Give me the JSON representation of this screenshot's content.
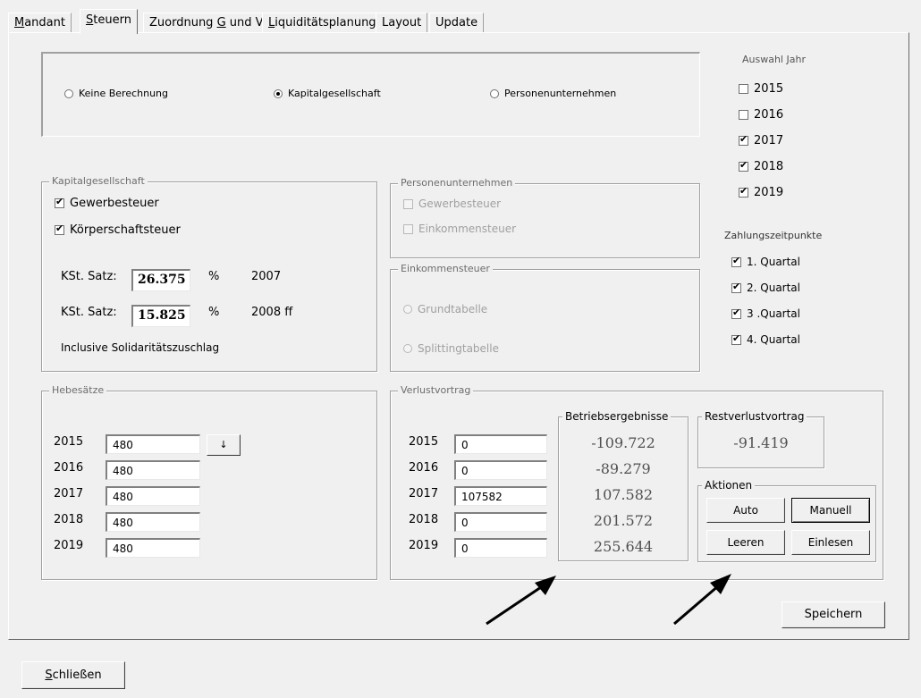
{
  "tabs": [
    {
      "pre": "",
      "key": "M",
      "post": "andant"
    },
    {
      "pre": "",
      "key": "S",
      "post": "teuern"
    },
    {
      "pre": "Zuordnung ",
      "key": "G",
      "post": " und V"
    },
    {
      "pre": "",
      "key": "L",
      "post": "iquiditätsplanung"
    },
    {
      "pre": "Layout",
      "key": "",
      "post": ""
    },
    {
      "pre": "Update",
      "key": "",
      "post": ""
    }
  ],
  "mode": {
    "none": "Keine Berechnung",
    "kapital": "Kapitalgesellschaft",
    "person": "Personenunternehmen",
    "selected": "kapital"
  },
  "kapital": {
    "title": "Kapitalgesellschaft",
    "gewerbe": {
      "label": "Gewerbesteuer",
      "checked": true
    },
    "koerperschaft": {
      "label": "Körperschaftsteuer",
      "checked": true
    },
    "rate1": {
      "label": "KSt. Satz:",
      "value": "26.375",
      "unit": "%",
      "year": "2007"
    },
    "rate2": {
      "label": "KSt. Satz:",
      "value": "15.825",
      "unit": "%",
      "year": "2008 ff"
    },
    "note": "Inclusive Solidaritätszuschlag"
  },
  "person": {
    "title": "Personenunternehmen",
    "gewerbe": "Gewerbesteuer",
    "einkommen": "Einkommensteuer"
  },
  "est": {
    "title": "Einkommensteuer",
    "grund": "Grundtabelle",
    "splitting": "Splittingtabelle"
  },
  "jahr": {
    "title": "Auswahl Jahr",
    "items": [
      {
        "label": "2015",
        "checked": false
      },
      {
        "label": "2016",
        "checked": false
      },
      {
        "label": "2017",
        "checked": true
      },
      {
        "label": "2018",
        "checked": true
      },
      {
        "label": "2019",
        "checked": true
      }
    ]
  },
  "zahlung": {
    "title": "Zahlungszeitpunkte",
    "items": [
      {
        "label": "1. Quartal",
        "checked": true
      },
      {
        "label": "2. Quartal",
        "checked": true
      },
      {
        "label": "3 .Quartal",
        "checked": true
      },
      {
        "label": "4. Quartal",
        "checked": true
      }
    ]
  },
  "hebe": {
    "title": "Hebesätze",
    "rows": [
      {
        "year": "2015",
        "value": "480"
      },
      {
        "year": "2016",
        "value": "480"
      },
      {
        "year": "2017",
        "value": "480"
      },
      {
        "year": "2018",
        "value": "480"
      },
      {
        "year": "2019",
        "value": "480"
      }
    ],
    "fill_symbol": "↓"
  },
  "verlust": {
    "title": "Verlustvortrag",
    "rows": [
      {
        "year": "2015",
        "value": "0"
      },
      {
        "year": "2016",
        "value": "0"
      },
      {
        "year": "2017",
        "value": "107582"
      },
      {
        "year": "2018",
        "value": "0"
      },
      {
        "year": "2019",
        "value": "0"
      }
    ],
    "ergebnis_title": "Betriebsergebnisse",
    "ergebnisse": [
      "-109.722",
      "-89.279",
      "107.582",
      "201.572",
      "255.644"
    ],
    "rest_title": "Restverlustvortrag",
    "rest_value": "-91.419",
    "aktionen_title": "Aktionen",
    "auto": "Auto",
    "manuell": "Manuell",
    "leeren": "Leeren",
    "einlesen": "Einlesen"
  },
  "save": "Speichern",
  "close": {
    "pre": "",
    "key": "S",
    "post": "chließen"
  }
}
